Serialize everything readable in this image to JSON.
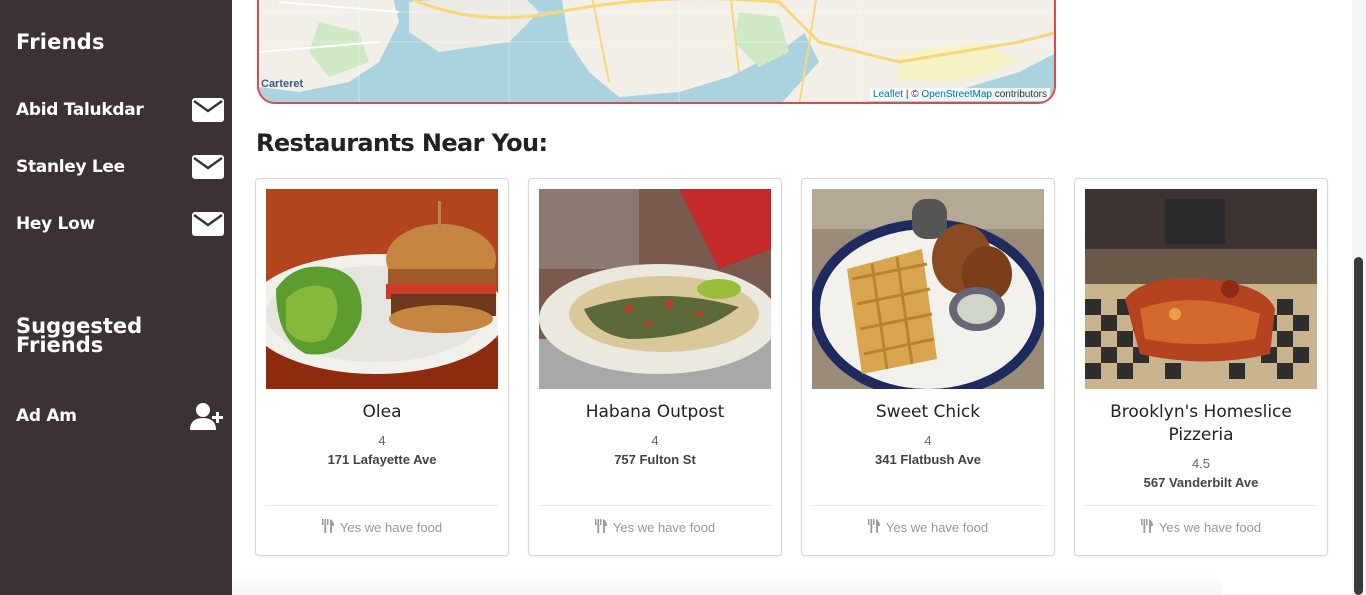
{
  "sidebar": {
    "friends_title": "Friends",
    "friends": [
      {
        "name": "Abid Talukdar",
        "icon": "envelope-icon"
      },
      {
        "name": "Stanley Lee",
        "icon": "envelope-icon"
      },
      {
        "name": "Hey Low",
        "icon": "envelope-icon"
      }
    ],
    "suggested_title": "Suggested Friends",
    "suggested": [
      {
        "name": "Ad Am",
        "icon": "add-user-icon"
      }
    ]
  },
  "map": {
    "place_label": "Carteret",
    "attribution_leaflet": "Leaflet",
    "attribution_sep": " | © ",
    "attribution_osm": "OpenStreetMap",
    "attribution_tail": " contributors"
  },
  "section_title": "Restaurants Near You:",
  "restaurants": [
    {
      "name": "Olea",
      "rating": "4",
      "address": "171 Lafayette Ave",
      "footer": "Yes we have food"
    },
    {
      "name": "Habana Outpost",
      "rating": "4",
      "address": "757 Fulton St",
      "footer": "Yes we have food"
    },
    {
      "name": "Sweet Chick",
      "rating": "4",
      "address": "341 Flatbush Ave",
      "footer": "Yes we have food"
    },
    {
      "name": "Brooklyn's Homeslice Pizzeria",
      "rating": "4.5",
      "address": "567 Vanderbilt Ave",
      "footer": "Yes we have food"
    }
  ],
  "colors": {
    "sidebar": "#3d3233",
    "map_border": "#e04848"
  }
}
